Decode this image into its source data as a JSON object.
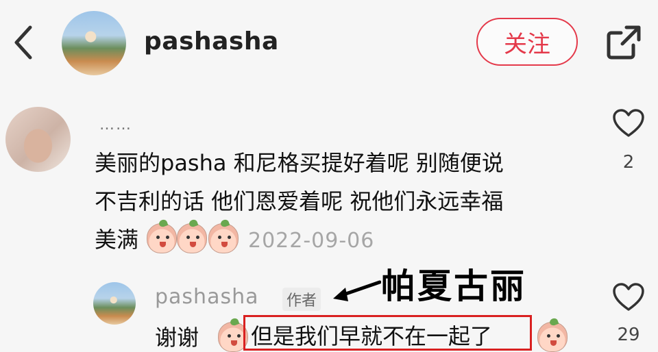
{
  "header": {
    "username": "pashasha",
    "follow_label": "关注"
  },
  "comment": {
    "author": "……",
    "lines": [
      "美丽的pasha 和尼格买提好着呢 别随便说",
      "不吉利的话 他们恩爱着呢  祝他们永远幸福",
      "美满"
    ],
    "date": "2022-09-06",
    "like_count": "2"
  },
  "reply": {
    "author": "pashasha",
    "author_badge": "作者",
    "annotation": "帕夏古丽",
    "thanks": "谢谢",
    "text": "但是我们早就不在一起了",
    "like_count": "29"
  },
  "colors": {
    "accent": "#e4394a",
    "highlight_box": "#d92020",
    "date": "#a6a6a6"
  },
  "icons": [
    "back-arrow-icon",
    "share-icon",
    "heart-icon",
    "emoji-sticker",
    "pointer-arrow-icon"
  ]
}
